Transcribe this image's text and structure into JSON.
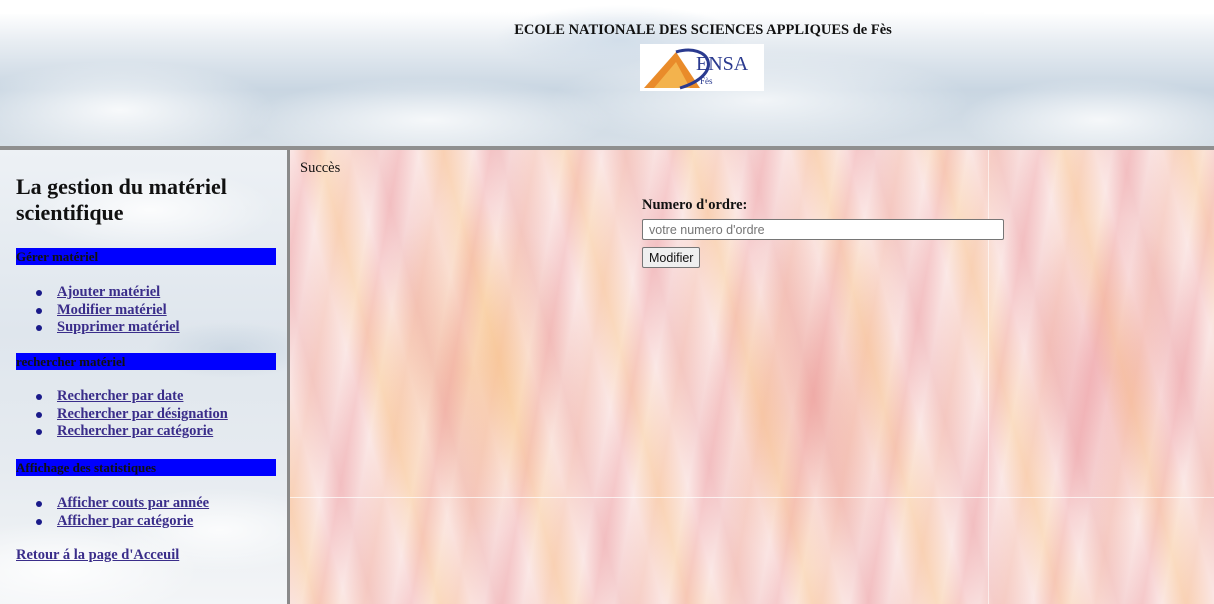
{
  "header": {
    "school_title": "ECOLE NATIONALE DES SCIENCES APPLIQUES de Fès",
    "logo_text": "ENSA",
    "logo_subtext": "Fès"
  },
  "sidebar": {
    "title": "La gestion du matériel scientifique",
    "sections": [
      {
        "heading": "Gérer matériel",
        "items": [
          {
            "label": "Ajouter matériel"
          },
          {
            "label": "Modifier matériel"
          },
          {
            "label": "Supprimer matériel"
          }
        ]
      },
      {
        "heading": "rechercher matériel",
        "items": [
          {
            "label": "Rechercher par date"
          },
          {
            "label": "Rechercher par désignation"
          },
          {
            "label": "Rechercher par catégorie"
          }
        ]
      },
      {
        "heading": "Affichage des statistiques",
        "items": [
          {
            "label": "Afficher couts par année"
          },
          {
            "label": "Afficher par catégorie"
          }
        ]
      }
    ],
    "home_link": "Retour á la page d'Acceuil",
    "section_bar_color": "#0000ff",
    "link_color": "#3a2d8a"
  },
  "main": {
    "status": "Succès",
    "form": {
      "label": "Numero d'ordre:",
      "input_value": "",
      "input_placeholder": "votre numero d'ordre",
      "button_label": "Modifier"
    }
  }
}
